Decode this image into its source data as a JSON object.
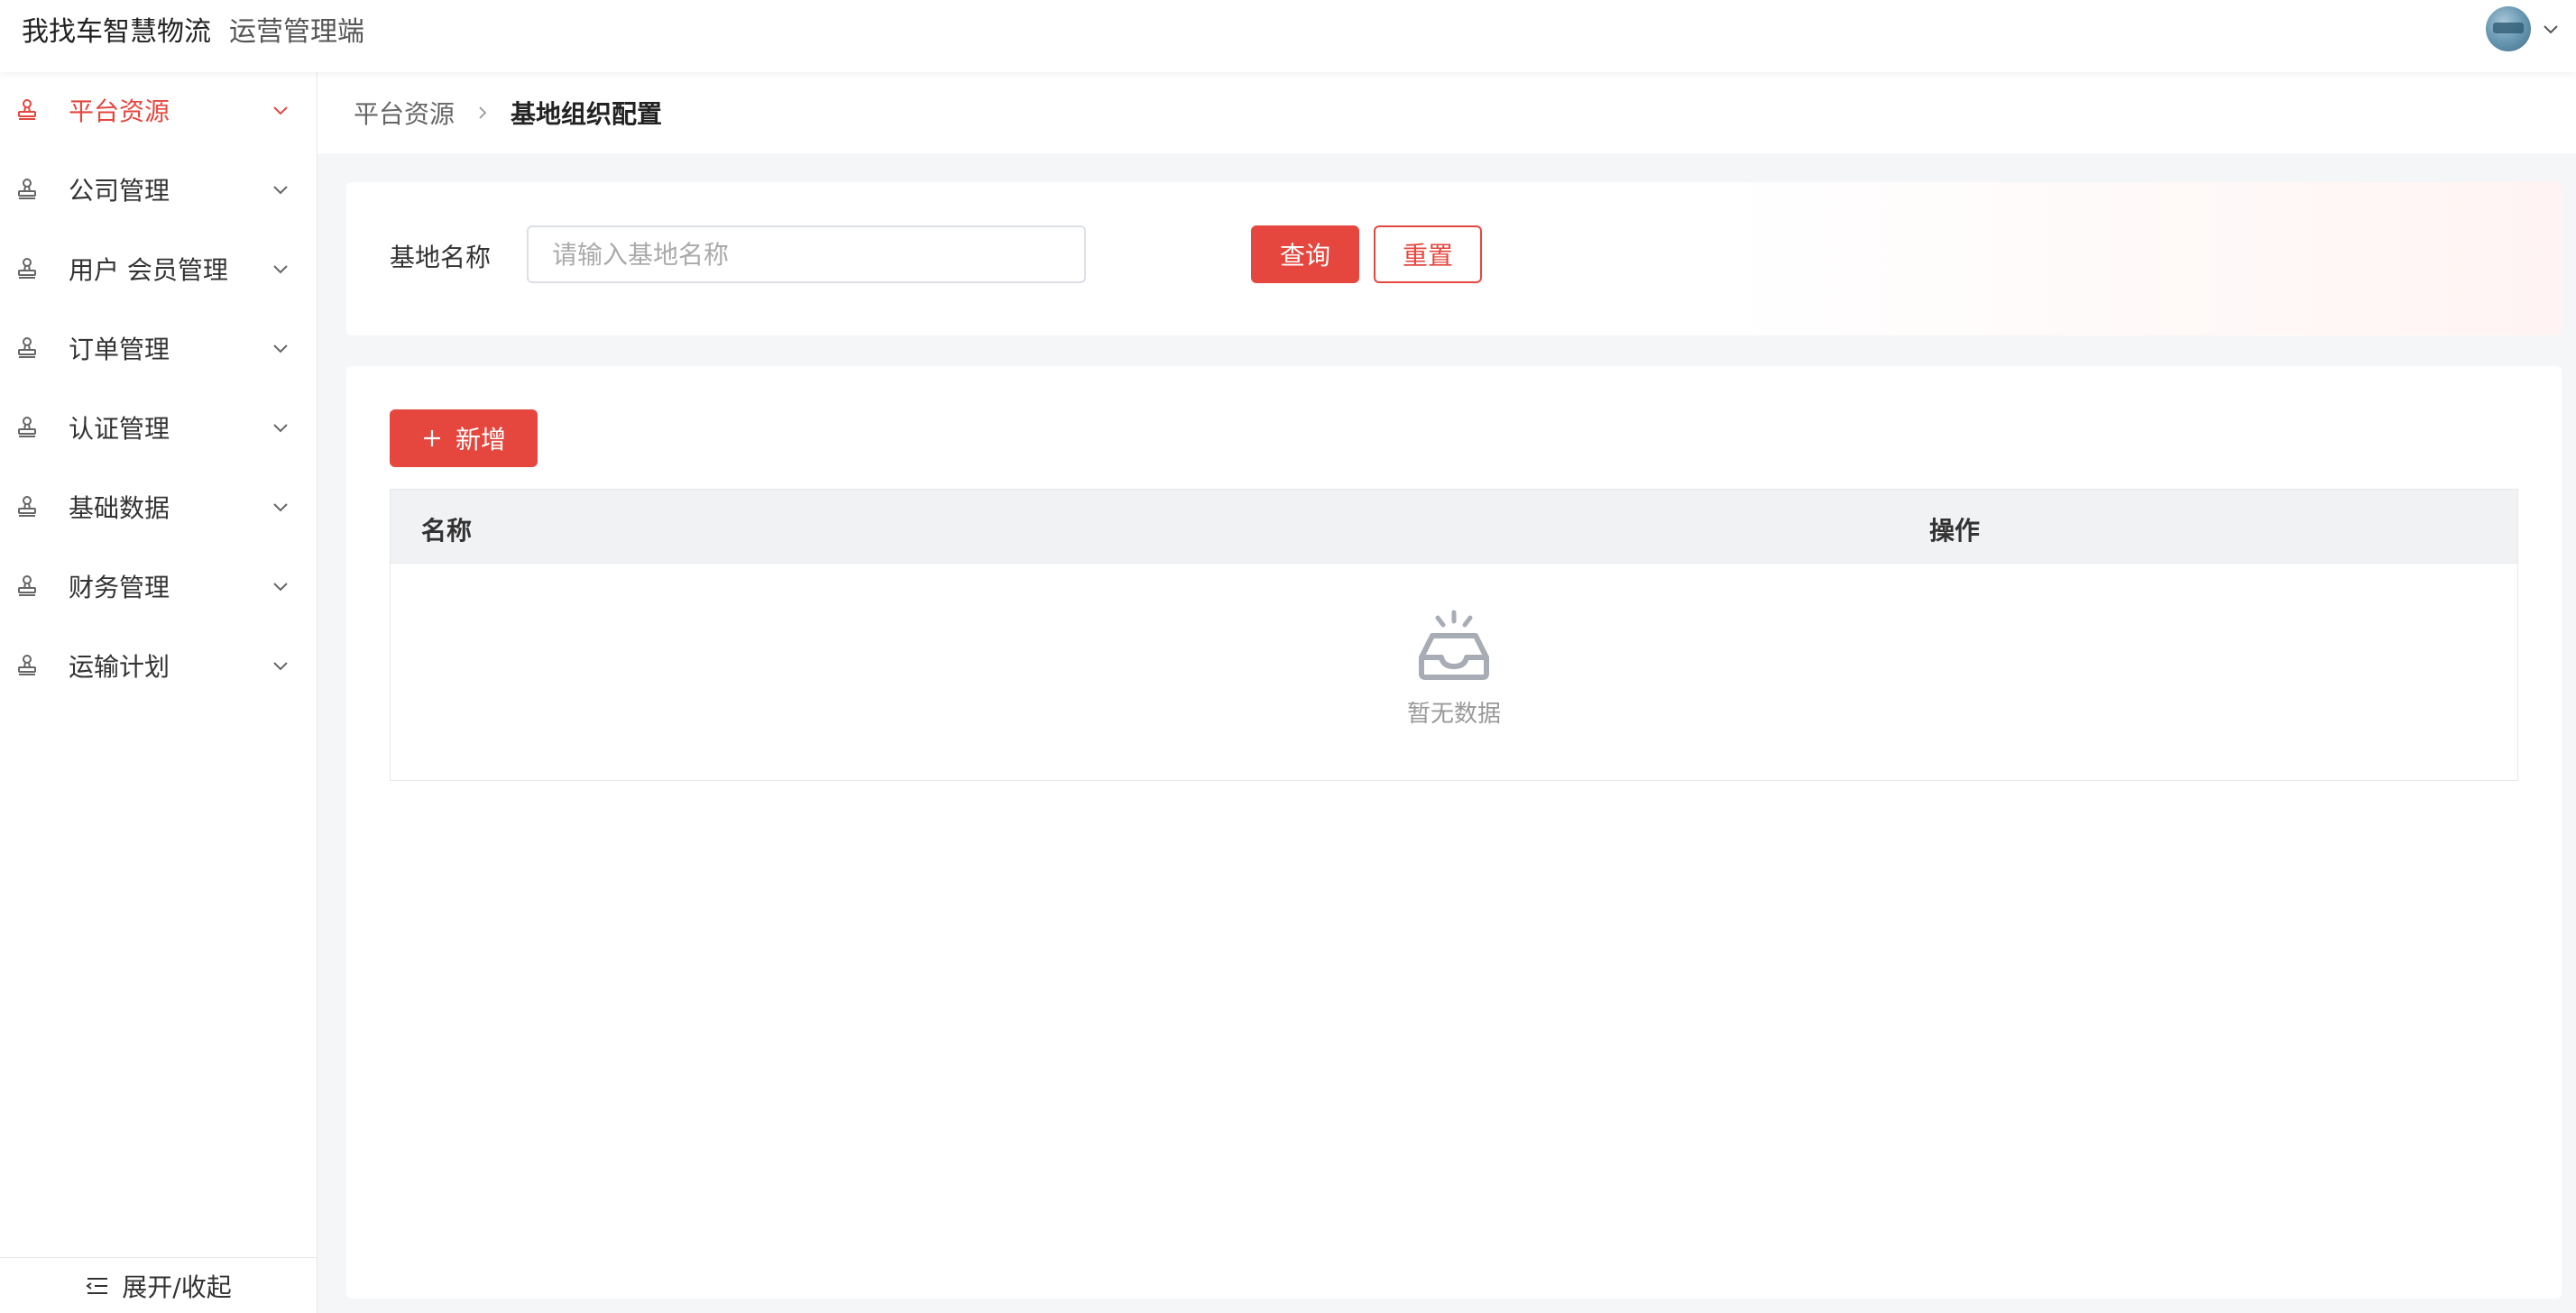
{
  "header": {
    "brand_name": "我找车智慧物流",
    "brand_sub": "运营管理端"
  },
  "sidebar": {
    "items": [
      {
        "label": "平台资源",
        "active": true
      },
      {
        "label": "公司管理",
        "active": false
      },
      {
        "label": "用户 会员管理",
        "active": false
      },
      {
        "label": "订单管理",
        "active": false
      },
      {
        "label": "认证管理",
        "active": false
      },
      {
        "label": "基础数据",
        "active": false
      },
      {
        "label": "财务管理",
        "active": false
      },
      {
        "label": "运输计划",
        "active": false
      }
    ],
    "footer_label": "展开/收起"
  },
  "breadcrumb": {
    "parent": "平台资源",
    "current": "基地组织配置"
  },
  "search": {
    "label": "基地名称",
    "placeholder": "请输入基地名称",
    "value": "",
    "query_label": "查询",
    "reset_label": "重置"
  },
  "table": {
    "add_label": "新增",
    "columns": [
      "名称",
      "操作"
    ],
    "rows": [],
    "empty_text": "暂无数据"
  },
  "colors": {
    "accent": "#e5473f",
    "muted_icon": "#a8adb5"
  }
}
